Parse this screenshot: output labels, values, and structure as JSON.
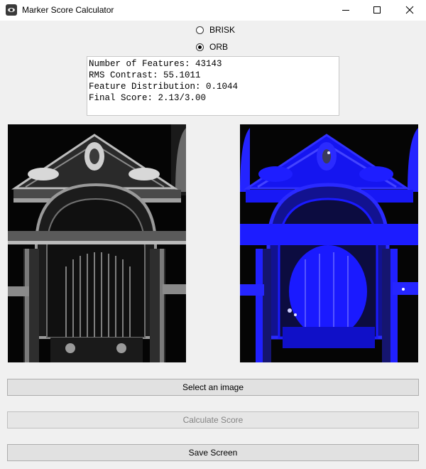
{
  "window": {
    "title": "Marker Score Calculator"
  },
  "options": [
    {
      "label": "BRISK",
      "checked": false
    },
    {
      "label": "ORB",
      "checked": true
    }
  ],
  "results": {
    "lines": [
      "Number of Features: 43143",
      "RMS Contrast: 55.1011",
      "Feature Distribution: 0.1044",
      "Final Score: 2.13/3.00"
    ]
  },
  "images": {
    "left": "original-grayscale-gate-image",
    "right": "feature-overlay-image",
    "overlay_color": "#1a1aff"
  },
  "buttons": {
    "select_label": "Select an image",
    "calculate_label": "Calculate Score",
    "save_label": "Save Screen"
  }
}
